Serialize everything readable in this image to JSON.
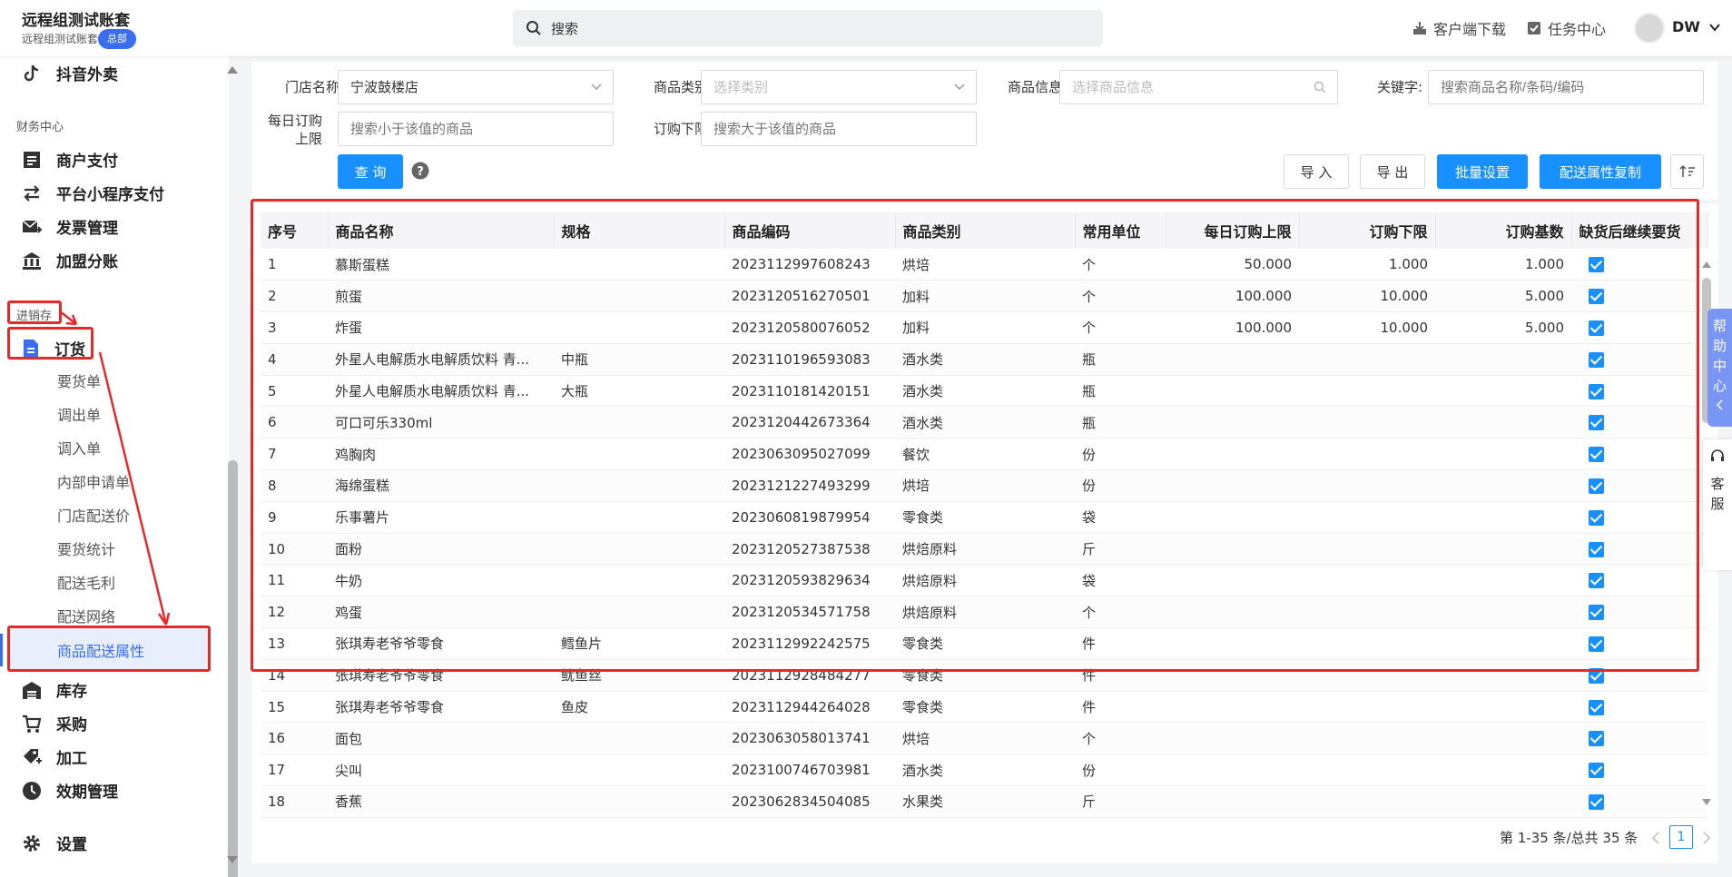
{
  "header": {
    "brand_title": "远程组测试账套",
    "brand_sub": "远程组测试账套",
    "brand_badge": "总部",
    "search_placeholder": "搜索",
    "client_download": "客户端下载",
    "task_center": "任务中心",
    "user": "DW"
  },
  "sidebar": {
    "douyin": "抖音外卖",
    "finance_section": "财务中心",
    "merchant_pay": "商户支付",
    "miniapp_pay": "平台小程序支付",
    "invoice": "发票管理",
    "franchise": "加盟分账",
    "inventory_section": "进销存",
    "order": "订货",
    "subs": [
      "要货单",
      "调出单",
      "调入单",
      "内部申请单",
      "门店配送价",
      "要货统计",
      "配送毛利",
      "配送网络",
      "商品配送属性"
    ],
    "stock": "库存",
    "purchase": "采购",
    "process": "加工",
    "expiry": "效期管理",
    "settings": "设置"
  },
  "filters": {
    "store_label": "门店名称:",
    "store_value": "宁波鼓楼店",
    "category_label": "商品类别:",
    "category_placeholder": "选择类别",
    "info_label": "商品信息:",
    "info_placeholder": "选择商品信息",
    "keyword_label": "关键字:",
    "keyword_placeholder": "搜索商品名称/条码/编码",
    "daily_limit_label_1": "每日订购",
    "daily_limit_label_2": "上限",
    "daily_limit_placeholder": "搜索小于该值的商品",
    "min_label": "订购下限:",
    "min_placeholder": "搜索大于该值的商品",
    "query_btn": "查 询",
    "import_btn": "导 入",
    "export_btn": "导 出",
    "batch_btn": "批量设置",
    "copy_btn": "配送属性复制"
  },
  "table": {
    "columns": [
      "序号",
      "商品名称",
      "规格",
      "商品编码",
      "商品类别",
      "常用单位",
      "每日订购上限",
      "订购下限",
      "订购基数",
      "缺货后继续要货"
    ],
    "rows": [
      [
        "1",
        "慕斯蛋糕",
        "",
        "2023112997608243",
        "烘培",
        "个",
        "50.000",
        "1.000",
        "1.000"
      ],
      [
        "2",
        "煎蛋",
        "",
        "2023120516270501",
        "加料",
        "个",
        "100.000",
        "10.000",
        "5.000"
      ],
      [
        "3",
        "炸蛋",
        "",
        "2023120580076052",
        "加料",
        "个",
        "100.000",
        "10.000",
        "5.000"
      ],
      [
        "4",
        "外星人电解质水电解质饮料 青...",
        "中瓶",
        "2023110196593083",
        "酒水类",
        "瓶",
        "",
        "",
        ""
      ],
      [
        "5",
        "外星人电解质水电解质饮料 青...",
        "大瓶",
        "2023110181420151",
        "酒水类",
        "瓶",
        "",
        "",
        ""
      ],
      [
        "6",
        "可口可乐330ml",
        "",
        "2023120442673364",
        "酒水类",
        "瓶",
        "",
        "",
        ""
      ],
      [
        "7",
        "鸡胸肉",
        "",
        "2023063095027099",
        "餐饮",
        "份",
        "",
        "",
        ""
      ],
      [
        "8",
        "海绵蛋糕",
        "",
        "2023121227493299",
        "烘培",
        "份",
        "",
        "",
        ""
      ],
      [
        "9",
        "乐事薯片",
        "",
        "2023060819879954",
        "零食类",
        "袋",
        "",
        "",
        ""
      ],
      [
        "10",
        "面粉",
        "",
        "2023120527387538",
        "烘焙原料",
        "斤",
        "",
        "",
        ""
      ],
      [
        "11",
        "牛奶",
        "",
        "2023120593829634",
        "烘焙原料",
        "袋",
        "",
        "",
        ""
      ],
      [
        "12",
        "鸡蛋",
        "",
        "2023120534571758",
        "烘焙原料",
        "个",
        "",
        "",
        ""
      ],
      [
        "13",
        "张琪寿老爷爷零食",
        "鳕鱼片",
        "2023112992242575",
        "零食类",
        "件",
        "",
        "",
        ""
      ],
      [
        "14",
        "张琪寿老爷爷零食",
        "鱿鱼丝",
        "2023112928484277",
        "零食类",
        "件",
        "",
        "",
        ""
      ],
      [
        "15",
        "张琪寿老爷爷零食",
        "鱼皮",
        "2023112944264028",
        "零食类",
        "件",
        "",
        "",
        ""
      ],
      [
        "16",
        "面包",
        "",
        "2023063058013741",
        "烘培",
        "个",
        "",
        "",
        ""
      ],
      [
        "17",
        "尖叫",
        "",
        "2023100746703981",
        "酒水类",
        "份",
        "",
        "",
        ""
      ],
      [
        "18",
        "香蕉",
        "",
        "2023062834504085",
        "水果类",
        "斤",
        "",
        "",
        ""
      ]
    ]
  },
  "pager": {
    "summary": "第 1-35 条/总共 35 条",
    "current": "1"
  },
  "side_tabs": {
    "help": "帮助中心",
    "service": "客服"
  }
}
